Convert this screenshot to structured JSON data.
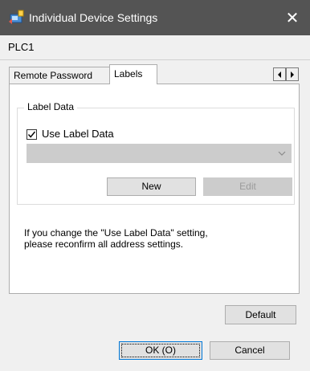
{
  "window": {
    "title": "Individual Device Settings",
    "close_label": "✕",
    "app_icon": "app-icon"
  },
  "device": {
    "name": "PLC1"
  },
  "tabs": [
    {
      "label": "Remote Password",
      "selected": false
    },
    {
      "label": "Labels",
      "selected": true
    }
  ],
  "tab_scroll": {
    "left_icon": "triangle-left-icon",
    "right_icon": "triangle-right-icon"
  },
  "label_data": {
    "group_title": "Label Data",
    "use_label_data": {
      "label": "Use Label Data",
      "checked": true
    },
    "combo": {
      "value": "",
      "enabled": false
    },
    "new_label": "New",
    "edit_label": "Edit"
  },
  "info_text": "If you change the \"Use Label Data\" setting,\nplease reconfirm all address settings.",
  "buttons": {
    "default_label": "Default",
    "ok_label": "OK (O)",
    "cancel_label": "Cancel"
  },
  "colors": {
    "titlebar": "#545454",
    "disabled_fill": "#cccccc",
    "focus_border": "#0078d7"
  }
}
